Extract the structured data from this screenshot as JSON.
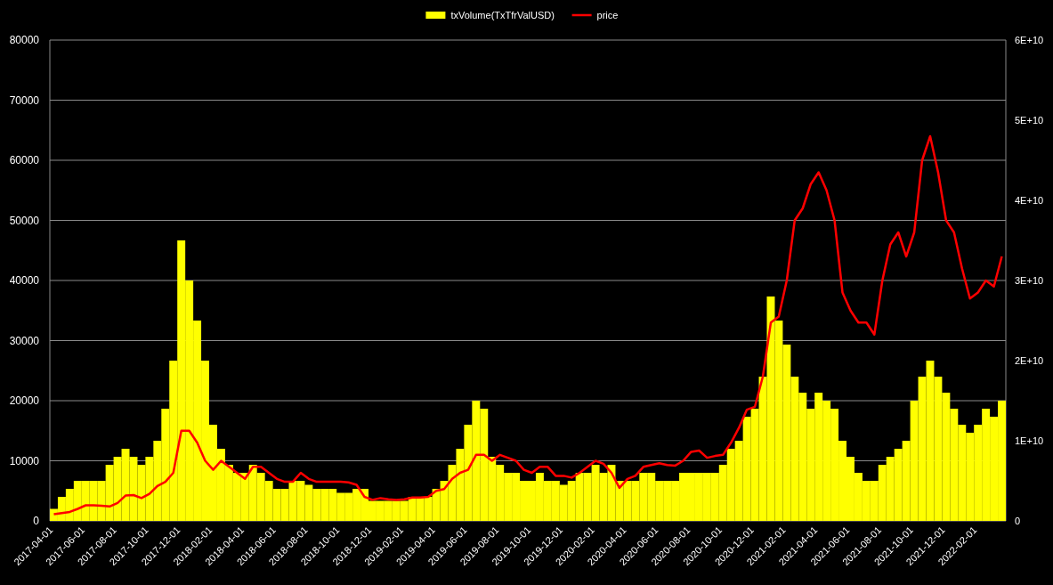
{
  "chart": {
    "chart_data": {
      "type": "bar",
      "categories": [
        "2017-04-01",
        null,
        null,
        null,
        "2017-06-01",
        null,
        null,
        null,
        "2017-08-01",
        null,
        null,
        null,
        "2017-10-01",
        null,
        null,
        null,
        "2017-12-01",
        null,
        null,
        null,
        "2018-02-01",
        null,
        null,
        null,
        "2018-04-01",
        null,
        null,
        null,
        "2018-06-01",
        null,
        null,
        null,
        "2018-08-01",
        null,
        null,
        null,
        "2018-10-01",
        null,
        null,
        null,
        "2018-12-01",
        null,
        null,
        null,
        "2019-02-01",
        null,
        null,
        null,
        "2019-04-01",
        null,
        null,
        null,
        "2019-06-01",
        null,
        null,
        null,
        "2019-08-01",
        null,
        null,
        null,
        "2019-10-01",
        null,
        null,
        null,
        "2019-12-01",
        null,
        null,
        null,
        "2020-02-01",
        null,
        null,
        null,
        "2020-04-01",
        null,
        null,
        null,
        "2020-06-01",
        null,
        null,
        null,
        "2020-08-01",
        null,
        null,
        null,
        "2020-10-01",
        null,
        null,
        null,
        "2020-12-01",
        null,
        null,
        null,
        "2021-02-01",
        null,
        null,
        null,
        "2021-04-01",
        null,
        null,
        null,
        "2021-06-01",
        null,
        null,
        null,
        "2021-08-01",
        null,
        null,
        null,
        "2021-10-01",
        null,
        null,
        null,
        "2021-12-01",
        null,
        null,
        null,
        "2022-02-01",
        null,
        null,
        null
      ],
      "series": [
        {
          "name": "txVolume(TxTfrValUSD)",
          "axis": "y2",
          "color": "#ffff00",
          "values": [
            1500000000.0,
            3000000000.0,
            4000000000.0,
            5000000000.0,
            5000000000.0,
            5000000000.0,
            5000000000.0,
            7000000000.0,
            8000000000.0,
            9000000000.0,
            8000000000.0,
            7000000000.0,
            8000000000.0,
            10000000000.0,
            14000000000.0,
            20000000000.0,
            35000000000.0,
            30000000000.0,
            25000000000.0,
            20000000000.0,
            12000000000.0,
            9000000000.0,
            7000000000.0,
            6000000000.0,
            6000000000.0,
            7000000000.0,
            6000000000.0,
            5000000000.0,
            4000000000.0,
            4000000000.0,
            5000000000.0,
            5000000000.0,
            4500000000.0,
            4000000000.0,
            4000000000.0,
            4000000000.0,
            3500000000.0,
            3500000000.0,
            4000000000.0,
            4000000000.0,
            2500000000.0,
            2500000000.0,
            2500000000.0,
            2500000000.0,
            2500000000.0,
            3000000000.0,
            3000000000.0,
            3000000000.0,
            4000000000.0,
            5000000000.0,
            7000000000.0,
            9000000000.0,
            12000000000.0,
            15000000000.0,
            14000000000.0,
            8000000000.0,
            7000000000.0,
            6000000000.0,
            6000000000.0,
            5000000000.0,
            5000000000.0,
            6000000000.0,
            5000000000.0,
            5000000000.0,
            4500000000.0,
            5000000000.0,
            6000000000.0,
            6000000000.0,
            7000000000.0,
            6000000000.0,
            7000000000.0,
            5000000000.0,
            5000000000.0,
            5000000000.0,
            6000000000.0,
            6000000000.0,
            5000000000.0,
            5000000000.0,
            5000000000.0,
            6000000000.0,
            6000000000.0,
            6000000000.0,
            6000000000.0,
            6000000000.0,
            7000000000.0,
            9000000000.0,
            10000000000.0,
            13000000000.0,
            14000000000.0,
            18000000000.0,
            28000000000.0,
            25000000000.0,
            22000000000.0,
            18000000000.0,
            16000000000.0,
            14000000000.0,
            16000000000.0,
            15000000000.0,
            14000000000.0,
            10000000000.0,
            8000000000.0,
            6000000000.0,
            5000000000.0,
            5000000000.0,
            7000000000.0,
            8000000000.0,
            9000000000.0,
            10000000000.0,
            15000000000.0,
            18000000000.0,
            20000000000.0,
            18000000000.0,
            16000000000.0,
            14000000000.0,
            12000000000.0,
            11000000000.0,
            12000000000.0,
            14000000000.0,
            13000000000.0,
            15000000000.0
          ]
        },
        {
          "name": "price",
          "type": "line",
          "color": "#ff0000",
          "values": [
            1100,
            1300,
            1500,
            2000,
            2600,
            2600,
            2500,
            2400,
            3000,
            4200,
            4300,
            3800,
            4500,
            5800,
            6500,
            8000,
            15000,
            15000,
            13000,
            10000,
            8500,
            10000,
            9000,
            8000,
            7000,
            9000,
            9000,
            8000,
            7000,
            6500,
            6500,
            8000,
            7000,
            6500,
            6500,
            6500,
            6500,
            6400,
            6000,
            4000,
            3500,
            3800,
            3600,
            3500,
            3600,
            3900,
            3900,
            4000,
            5000,
            5300,
            7000,
            8000,
            8500,
            11000,
            11000,
            10000,
            11000,
            10500,
            10000,
            8500,
            8000,
            9000,
            9000,
            7500,
            7500,
            7200,
            8000,
            9000,
            10000,
            9500,
            8000,
            5500,
            7000,
            7500,
            9000,
            9300,
            9600,
            9300,
            9200,
            10000,
            11500,
            11700,
            10500,
            10800,
            11000,
            13000,
            15500,
            18500,
            19000,
            24000,
            33000,
            34000,
            40000,
            50000,
            52000,
            56000,
            58000,
            55000,
            50000,
            38000,
            35000,
            33000,
            33000,
            31000,
            40000,
            46000,
            48000,
            44000,
            48000,
            60000,
            64000,
            58000,
            50000,
            48000,
            42000,
            37000,
            38000,
            40000,
            39000,
            44000
          ]
        }
      ],
      "ylim": [
        0,
        80000
      ],
      "yticks": [
        0,
        10000,
        20000,
        30000,
        40000,
        50000,
        60000,
        70000,
        80000
      ],
      "y2lim": [
        0,
        60000000000.0
      ],
      "y2ticks": [
        {
          "value": 0,
          "label": "0"
        },
        {
          "value": 10000000000.0,
          "label": "1E+10"
        },
        {
          "value": 20000000000.0,
          "label": "2E+10"
        },
        {
          "value": 30000000000.0,
          "label": "3E+10"
        },
        {
          "value": 40000000000.0,
          "label": "4E+10"
        },
        {
          "value": 50000000000.0,
          "label": "5E+10"
        },
        {
          "value": 60000000000.0,
          "label": "6E+10"
        }
      ],
      "grid": true,
      "legend": "top"
    }
  }
}
